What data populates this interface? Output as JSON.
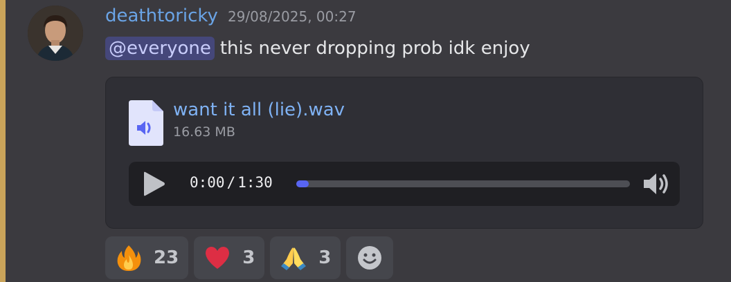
{
  "message": {
    "author": "deathtoricky",
    "timestamp": "29/08/2025, 00:27",
    "mention": "@everyone",
    "text": "this never dropping prob idk enjoy"
  },
  "attachment": {
    "file_name": "want it all (lie).wav",
    "file_size": "16.63 MB",
    "player": {
      "current_time": "0:00",
      "separator": "/",
      "duration": "1:30",
      "progress": 0.0
    }
  },
  "reactions": [
    {
      "icon": "fire-emoji",
      "count": "23"
    },
    {
      "icon": "heart-emoji",
      "count": "3"
    },
    {
      "icon": "folded-hands-emoji",
      "count": "3"
    },
    {
      "icon": "add-reaction-icon"
    }
  ],
  "colors": {
    "username": "#6aa4e6",
    "mention_bg": "#45477a",
    "link": "#7fb2f4",
    "progress_fill": "#5865f2",
    "mention_bar": "#c9a35a"
  }
}
